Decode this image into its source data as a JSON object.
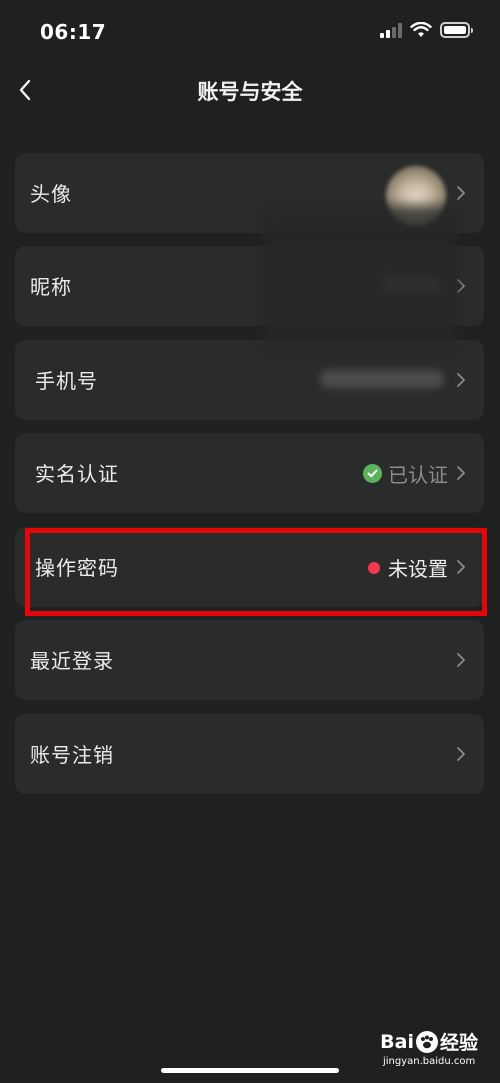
{
  "status_bar": {
    "time": "06:17",
    "signal_icon": "cellular-signal-icon",
    "wifi_icon": "wifi-icon",
    "battery_icon": "battery-icon"
  },
  "nav": {
    "title": "账号与安全",
    "back_icon": "chevron-left-icon"
  },
  "rows": [
    {
      "label": "头像",
      "value_type": "avatar"
    },
    {
      "label": "昵称",
      "value_type": "blurred"
    },
    {
      "label": "手机号",
      "value_type": "blurred"
    },
    {
      "label": "实名认证",
      "value": "已认证",
      "value_type": "verified"
    },
    {
      "label": "操作密码",
      "value": "未设置",
      "value_type": "unset"
    },
    {
      "label": "最近登录"
    },
    {
      "label": "账号注销"
    }
  ],
  "colors": {
    "background": "#1f2120",
    "row_background": "#2a2c2b",
    "verified_green": "#5ab45c",
    "unset_red": "#f0384f",
    "highlight_red": "#e3070c"
  },
  "watermark": {
    "logo_text_1": "Bai",
    "logo_text_2": "经验",
    "url": "jingyan.baidu.com"
  }
}
